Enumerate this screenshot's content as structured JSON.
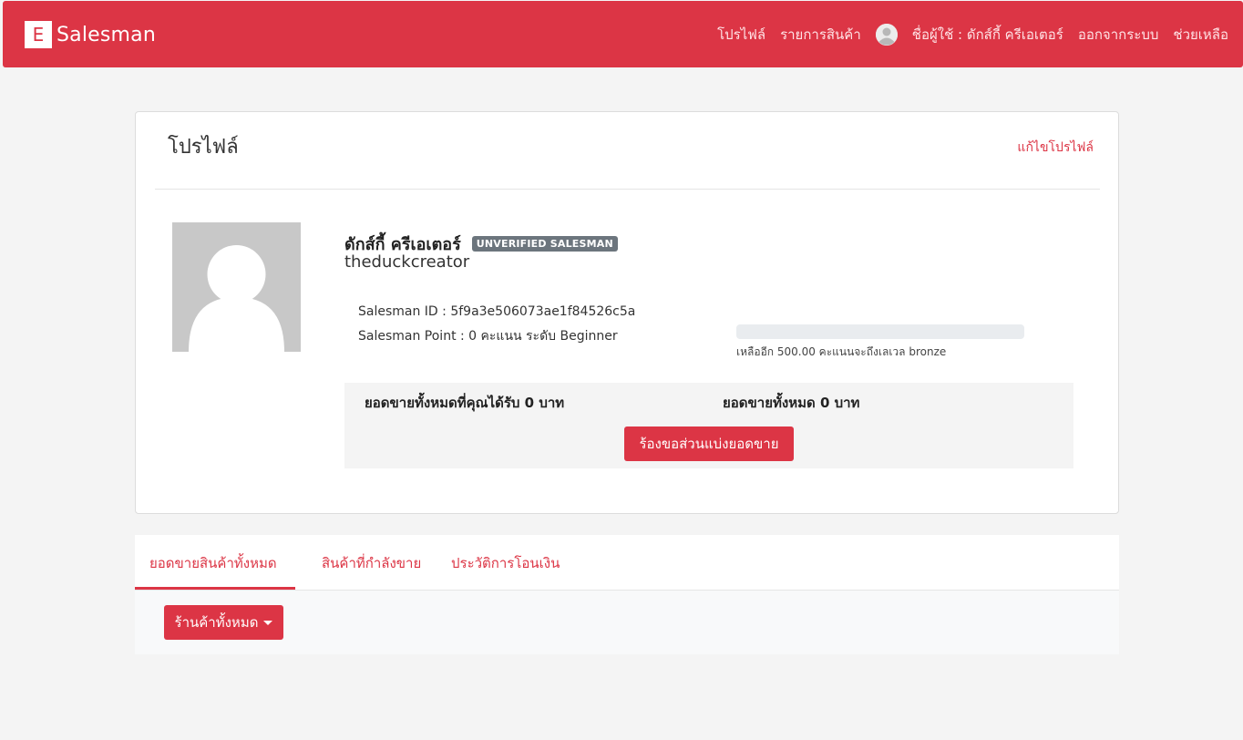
{
  "navbar": {
    "brand_letter": "E",
    "brand_name": "Salesman",
    "links": {
      "profile": "โปรไฟล์",
      "products": "รายการสินค้า",
      "username": "ชื่อผู้ใช้ : ดักส์กี้ ครีเอเตอร์",
      "logout": "ออกจากระบบ",
      "help": "ช่วยเหลือ"
    }
  },
  "profile": {
    "title": "โปรไฟล์",
    "edit_link": "แก้ไขโปรไฟล์",
    "display_name": "ดักส์กี้ ครีเอเตอร์",
    "badge": "UNVERIFIED SALESMAN",
    "username": "theduckcreator",
    "salesman_id": "Salesman ID : 5f9a3e506073ae1f84526c5a",
    "salesman_point": "Salesman Point : 0 คะแนน ระดับ  Beginner",
    "progress_percent": 0,
    "progress_note": "เหลืออีก 500.00 คะแนนจะถึงเลเวล bronze",
    "earned_total": "ยอดขายทั้งหมดที่คุณได้รับ 0 บาท",
    "sales_total": "ยอดขายทั้งหมด 0 บาท",
    "request_button": "ร้องขอส่วนแบ่งยอดขาย"
  },
  "tabs": [
    {
      "label": "ยอดขายสินค้าทั้งหมด",
      "active": true
    },
    {
      "label": "สินค้าที่กำลังขาย",
      "active": false
    },
    {
      "label": "ประวัติการโอนเงิน",
      "active": false
    }
  ],
  "filter": {
    "dropdown_label": "ร้านค้าทั้งหมด"
  },
  "colors": {
    "primary": "#dc3545",
    "badge": "#6c757d"
  }
}
